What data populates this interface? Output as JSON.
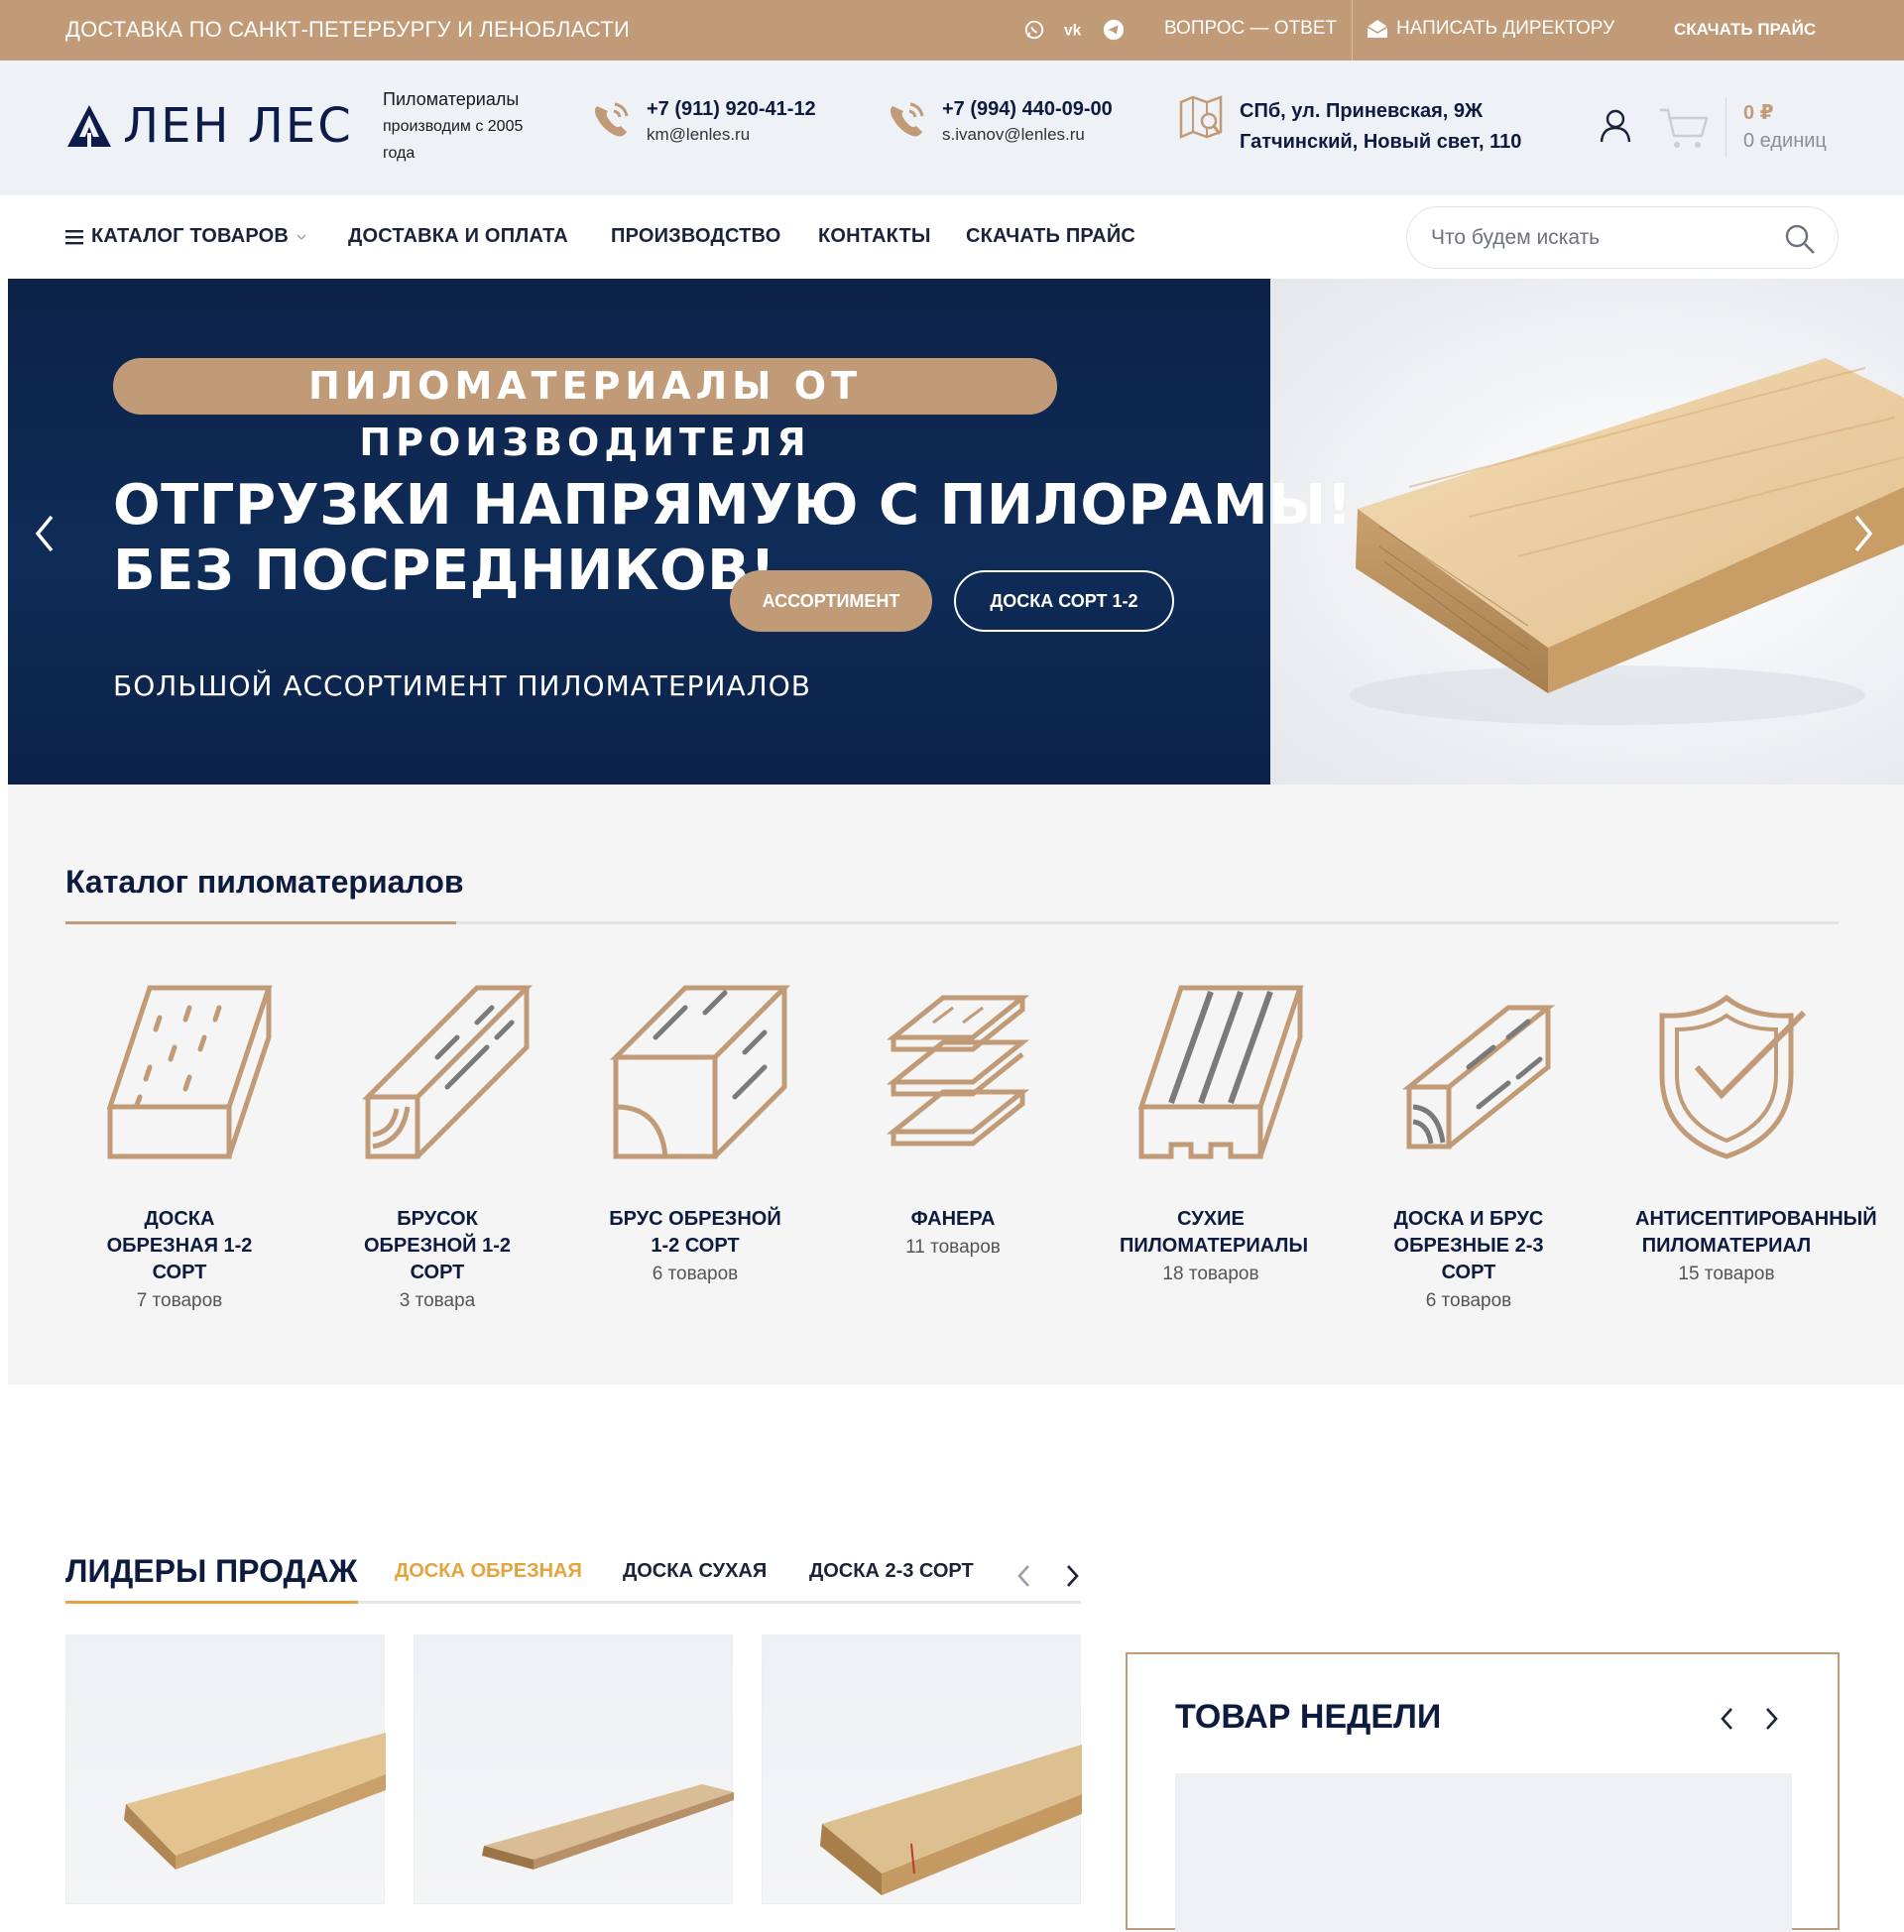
{
  "topbar": {
    "delivery": "ДОСТАВКА ПО САНКТ-ПЕТЕРБУРГУ И ЛЕНОБЛАСТИ",
    "social_icons": [
      "whatsapp-icon",
      "vk-icon",
      "telegram-icon"
    ],
    "faq": "ВОПРОС — ОТВЕТ",
    "director": "НАПИСАТЬ ДИРЕКТОРУ",
    "price": "СКАЧАТЬ ПРАЙС",
    "bg_color": "#c19b77"
  },
  "header": {
    "logo": "ЛЕН ЛЕС",
    "tagline_line1": "Пиломатериалы",
    "tagline_line2": "производим с 2005 года",
    "phone1": "+7 (911) 920-41-12",
    "email1": "km@lenles.ru",
    "phone2": "+7 (994) 440-09-00",
    "email2": "s.ivanov@lenles.ru",
    "address_line1": "СПб, ул. Приневская, 9Ж",
    "address_line2": "Гатчинский, Новый свет, 110",
    "cart_sum": "0 ₽",
    "cart_count": "0 единиц"
  },
  "nav": {
    "catalog": "КАТАЛОГ ТОВАРОВ",
    "delivery": "ДОСТАВКА И ОПЛАТА",
    "production": "ПРОИЗВОДСТВО",
    "contacts": "КОНТАКТЫ",
    "price": "СКАЧАТЬ ПРАЙС",
    "search_placeholder": "Что будем искать"
  },
  "hero": {
    "badge": "ПИЛОМАТЕРИАЛЫ ОТ ПРОИЗВОДИТЕЛЯ",
    "title_line1": "ОТГРУЗКИ НАПРЯМУЮ С  ПИЛОРАМЫ!",
    "title_line2": "БЕЗ ПОСРЕДНИКОВ!",
    "btn_assortment": "АССОРТИМЕНТ",
    "btn_board": "ДОСКА СОРТ 1-2",
    "subtitle": "БОЛЬШОЙ АССОРТИМЕНТ ПИЛОМАТЕРИАЛОВ",
    "dark_color": "#0c2248"
  },
  "catalog": {
    "title": "Каталог пиломатериалов",
    "items": [
      {
        "name": "ДОСКА ОБРЕЗНАЯ 1-2 СОРТ",
        "count": "7 товаров"
      },
      {
        "name": "БРУСОК ОБРЕЗНОЙ 1-2 СОРТ",
        "count": "3 товара"
      },
      {
        "name": "БРУС ОБРЕЗНОЙ 1-2 СОРТ",
        "count": "6 товаров"
      },
      {
        "name": "ФАНЕРА",
        "count": "11 товаров"
      },
      {
        "name": "СУХИЕ ПИЛОМАТЕРИАЛЫ",
        "count": "18 товаров"
      },
      {
        "name": "ДОСКА И БРУС ОБРЕЗНЫЕ 2-3 СОРТ",
        "count": "6 товаров"
      },
      {
        "name": "АНТИСЕПТИРОВАННЫЙ ПИЛОМАТЕРИАЛ",
        "count": "15 товаров"
      }
    ]
  },
  "leaders": {
    "title": "ЛИДЕРЫ ПРОДАЖ",
    "tabs": [
      "ДОСКА ОБРЕЗНАЯ",
      "ДОСКА СУХАЯ",
      "ДОСКА 2-3 СОРТ"
    ],
    "accent_color": "#e3a440"
  },
  "week": {
    "title": "ТОВАР НЕДЕЛИ"
  }
}
